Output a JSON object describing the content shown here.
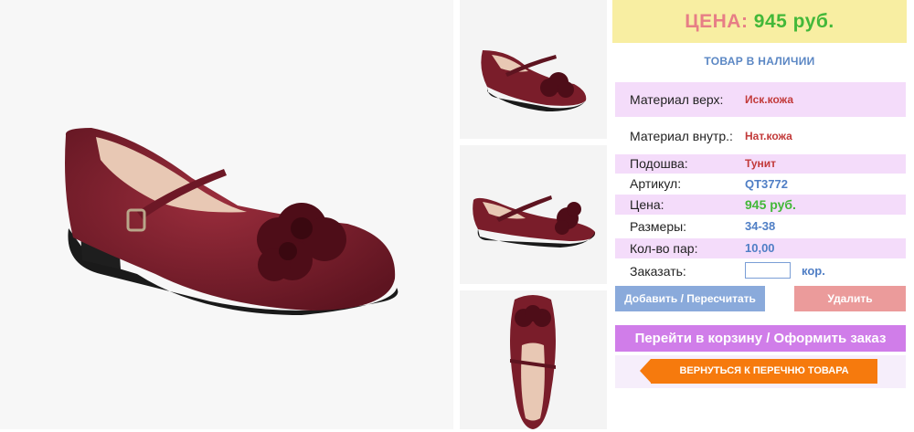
{
  "price_box": {
    "label": "ЦЕНА:",
    "value": "945 руб."
  },
  "stock_status": "ТОВАР В НАЛИЧИИ",
  "details": [
    {
      "label": "Материал верх:",
      "value": "Иск.кожа"
    },
    {
      "label": "Материал внутр.:",
      "value": "Нат.кожа"
    },
    {
      "label": "Подошва:",
      "value": "Тунит"
    },
    {
      "label": "Артикул:",
      "value": "QT3772"
    },
    {
      "label": "Цена:",
      "value": "945 руб."
    },
    {
      "label": "Размеры:",
      "value": "34-38"
    },
    {
      "label": "Кол-во пар:",
      "value": "10,00"
    }
  ],
  "order": {
    "label": "Заказать:",
    "value": "",
    "unit": "кор."
  },
  "buttons": {
    "add": "Добавить / Пересчитать",
    "delete": "Удалить",
    "cart": "Перейти в корзину / Оформить заказ",
    "back": "ВЕРНУТЬСЯ К ПЕРЕЧНЮ ТОВАРА"
  },
  "colors": {
    "product": "#7a1d2a",
    "price_bg": "#f8eea2",
    "accent_pink": "#f4dcfa",
    "cart_button": "#d07de9",
    "back_button": "#f67a0d"
  }
}
